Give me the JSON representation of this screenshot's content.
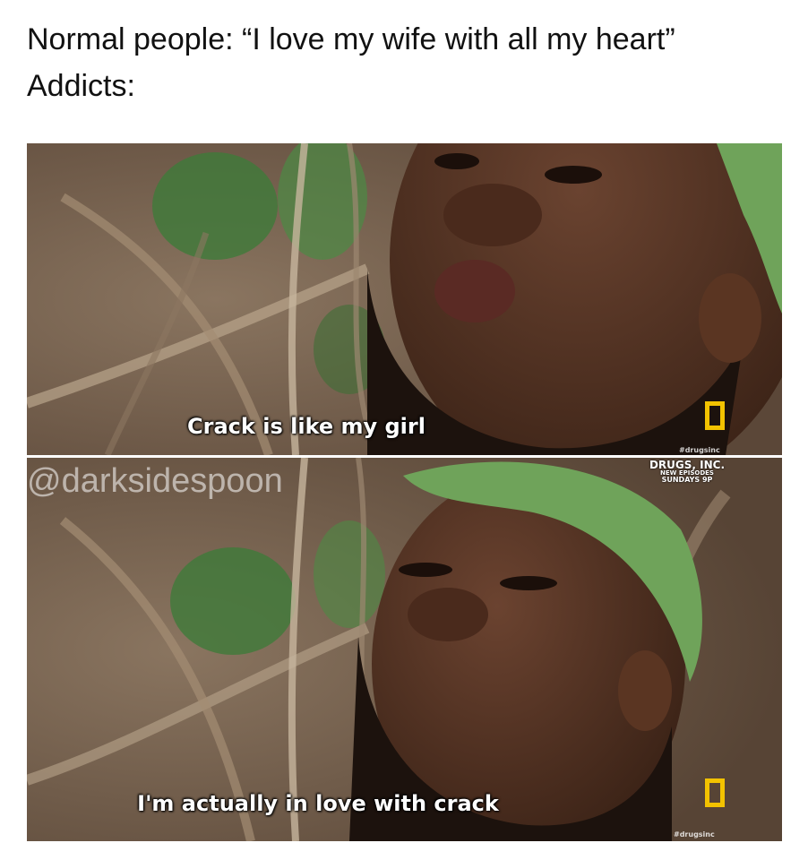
{
  "caption": {
    "line1": "Normal people: “I love my wife with all my heart”",
    "line2": "Addicts:"
  },
  "panels": {
    "top": {
      "subtitle": "Crack is like my girl",
      "handle": "#drugsinc"
    },
    "bottom": {
      "subtitle": "I'm actually in love with crack",
      "handle": "#drugsinc",
      "promo": {
        "title": "DRUGS, INC.",
        "line2": "NEW EPISODES",
        "line3": "SUNDAYS 9P"
      }
    }
  },
  "watermark": "@darksidespoon",
  "colors": {
    "subtitle_text": "#ffffff",
    "logo_yellow": "#f2c200",
    "caption_text": "#111111",
    "skin": "#4a2c1c",
    "hat_green": "#6fa35a",
    "background_branches": "#7a6552"
  },
  "icons": {
    "channel_logo": "national-geographic-yellow-frame"
  }
}
